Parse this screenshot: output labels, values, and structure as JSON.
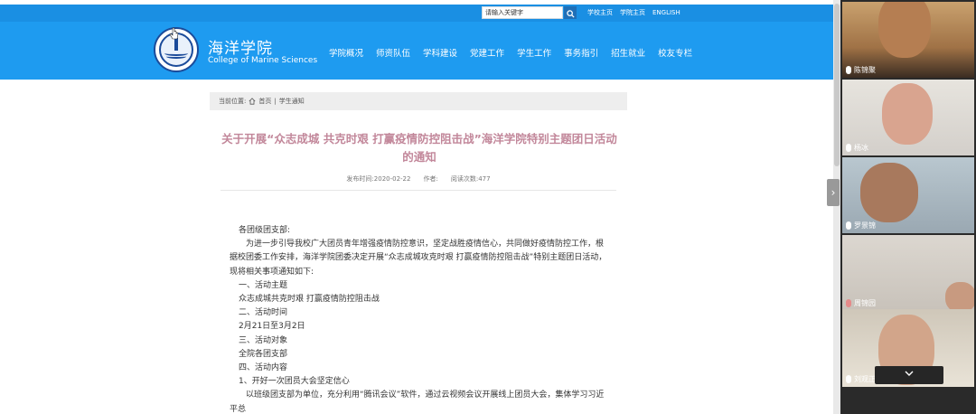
{
  "topbar": {
    "search_placeholder": "请输入关键字",
    "links": [
      "学校主页",
      "学院主页",
      "ENGLISH"
    ]
  },
  "header": {
    "college_cn": "海洋学院",
    "college_en": "College of Marine Sciences",
    "nav": [
      "学院概况",
      "师资队伍",
      "学科建设",
      "党建工作",
      "学生工作",
      "事务指引",
      "招生就业",
      "校友专栏"
    ]
  },
  "breadcrumb": {
    "prefix": "当前位置:",
    "home": "首页",
    "separator": "|",
    "current": "学生通知"
  },
  "article": {
    "title": "关于开展“众志成城 共克时艰 打赢疫情防控阻击战”海洋学院特别主题团日活动的通知",
    "publish_label": "发布时间:",
    "publish_date": "2020-02-22",
    "author_label": "作者:",
    "views_label": "阅读次数:",
    "views": "477",
    "paragraphs": [
      "各团级团支部:",
      "为进一步引导我校广大团员青年增强疫情防控意识，坚定战胜疫情信心，共同做好疫情防控工作，根据校团委工作安排，海洋学院团委决定开展“众志成城攻克时艰 打赢疫情防控阻击战”特别主题团日活动，现将相关事项通知如下:",
      "一、活动主题",
      "众志成城共克时艰 打赢疫情防控阻击战",
      "二、活动时间",
      "2月21日至3月2日",
      "三、活动对象",
      "全院各团支部",
      "四、活动内容",
      "1、开好一次团员大会坚定信心",
      "以班级团支部为单位，充分利用“腾讯会议”软件，通过云视频会议开展线上团员大会，集体学习习近平总"
    ]
  },
  "participants": [
    {
      "name": "陈锦聚"
    },
    {
      "name": "杨冰"
    },
    {
      "name": "罗景锦"
    },
    {
      "name": "周锦园"
    },
    {
      "name": "刘观正"
    }
  ]
}
